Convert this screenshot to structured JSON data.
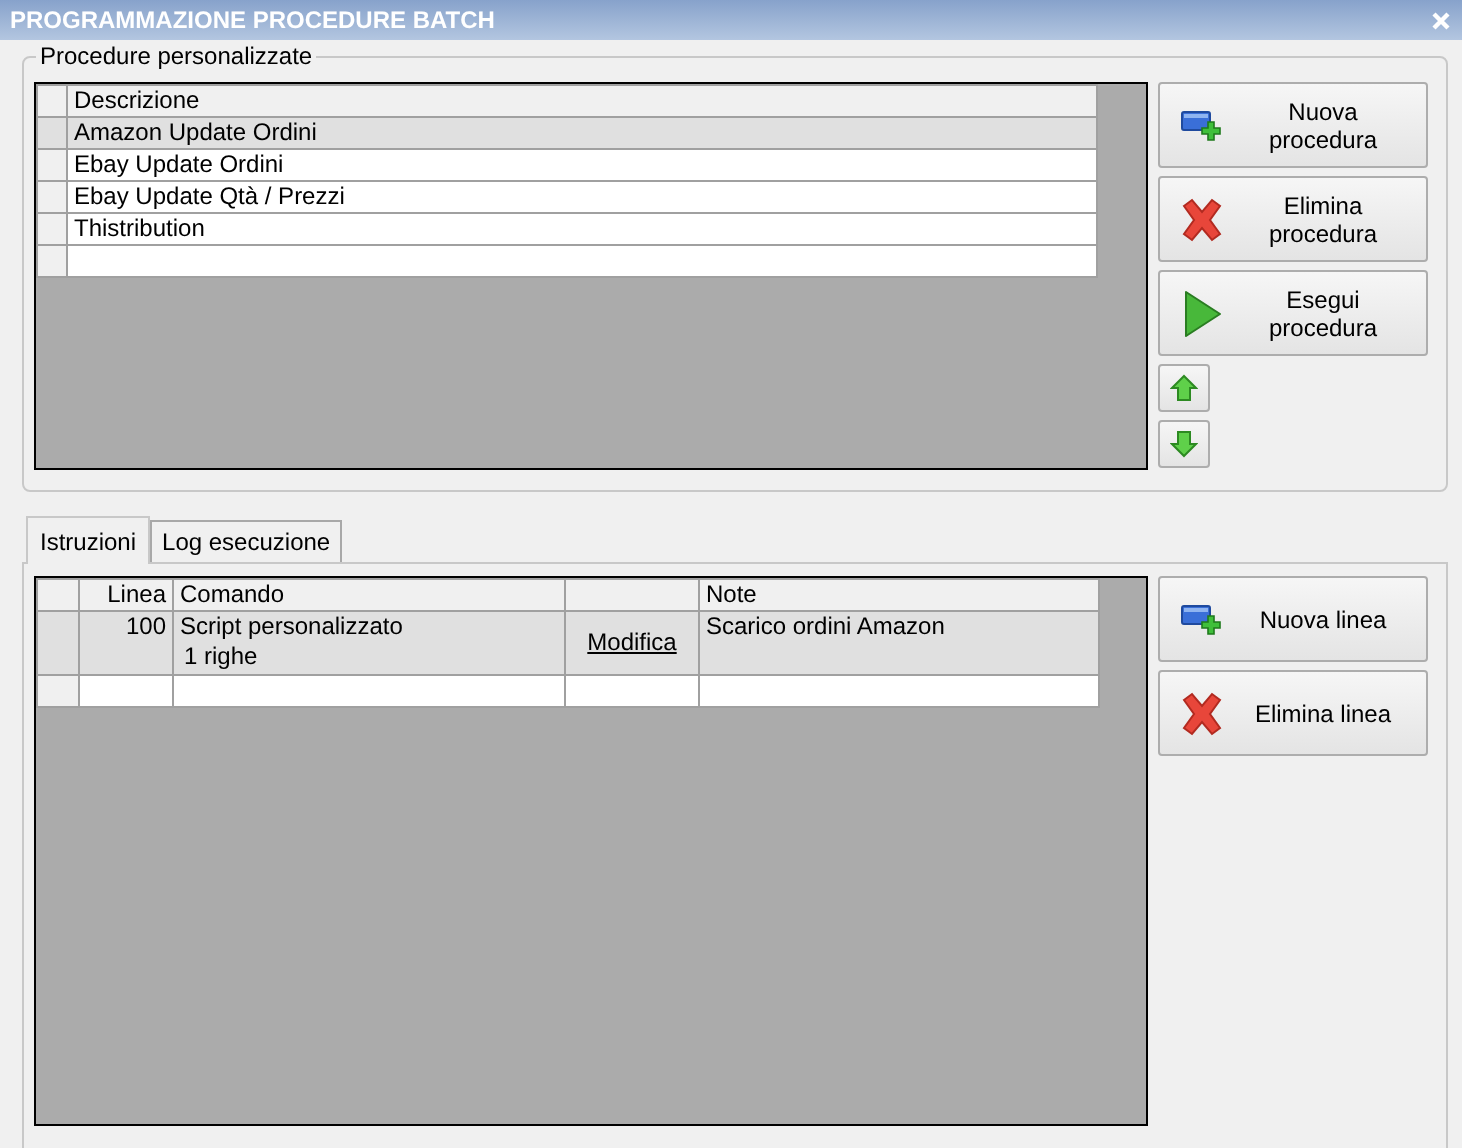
{
  "window": {
    "title": "PROGRAMMAZIONE PROCEDURE BATCH"
  },
  "procedures": {
    "legend": "Procedure personalizzate",
    "column": "Descrizione",
    "rows": [
      {
        "label": "Amazon Update Ordini",
        "selected": true
      },
      {
        "label": "Ebay Update Ordini",
        "selected": false
      },
      {
        "label": "Ebay Update Qtà / Prezzi",
        "selected": false
      },
      {
        "label": "Thistribution",
        "selected": false
      }
    ],
    "buttons": [
      {
        "label": "Nuova procedura",
        "kind": "add"
      },
      {
        "label": "Elimina procedura",
        "kind": "delete"
      },
      {
        "label": "Esegui procedura",
        "kind": "run"
      }
    ],
    "move_buttons": [
      {
        "kind": "up"
      },
      {
        "kind": "down"
      }
    ]
  },
  "tabs": [
    {
      "label": "Istruzioni",
      "selected": true
    },
    {
      "label": "Log esecuzione",
      "selected": false
    }
  ],
  "lines": {
    "columns": {
      "line": "Linea",
      "command": "Comando",
      "note": "Note"
    },
    "rows": [
      {
        "line": "100",
        "command": "Script personalizzato",
        "command_detail": "1 righe",
        "action": "Modifica",
        "note": "Scarico ordini Amazon",
        "selected": true
      }
    ],
    "buttons": [
      {
        "label": "Nuova linea",
        "kind": "add"
      },
      {
        "label": "Elimina linea",
        "kind": "delete"
      }
    ]
  }
}
